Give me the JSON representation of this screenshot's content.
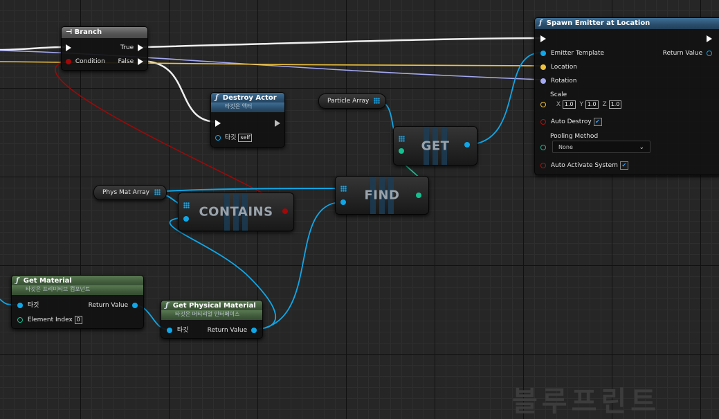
{
  "nodes": {
    "branch": {
      "title": "Branch",
      "true_label": "True",
      "false_label": "False",
      "condition_label": "Condition"
    },
    "destroy_actor": {
      "title": "Destroy Actor",
      "subtitle": "타깃은 액터",
      "target_label": "타깃",
      "target_value": "self"
    },
    "spawn_emitter": {
      "title": "Spawn Emitter at Location",
      "emitter_template_label": "Emitter Template",
      "return_value_label": "Return Value",
      "location_label": "Location",
      "rotation_label": "Rotation",
      "scale_label": "Scale",
      "scale_x_label": "X",
      "scale_x": "1.0",
      "scale_y_label": "Y",
      "scale_y": "1.0",
      "scale_z_label": "Z",
      "scale_z": "1.0",
      "auto_destroy_label": "Auto Destroy",
      "pooling_method_label": "Pooling Method",
      "pooling_method_value": "None",
      "auto_activate_label": "Auto Activate System"
    },
    "get_material": {
      "title": "Get Material",
      "subtitle": "타깃은 프리미티브 컴포넌트",
      "target_label": "타깃",
      "return_value_label": "Return Value",
      "element_index_label": "Element Index",
      "element_index_value": "0"
    },
    "get_physical_material": {
      "title": "Get Physical Material",
      "subtitle": "타깃은 머티리얼 인터페이스",
      "target_label": "타깃",
      "return_value_label": "Return Value"
    },
    "get": {
      "title": "GET"
    },
    "find": {
      "title": "FIND"
    },
    "contains": {
      "title": "CONTAINS"
    }
  },
  "variables": {
    "particle_array": "Particle Array",
    "phys_mat_array": "Phys Mat Array"
  },
  "icons": {
    "function": "ƒ",
    "branch": "branch-icon",
    "exec_pin": "exec-pin-icon",
    "array_pin": "array-grid-icon",
    "chevron": "chevron-down-icon"
  },
  "colors": {
    "exec_wire": "#ffffff",
    "object_wire": "#0fa7e8",
    "vector_wire": "#f0c23c",
    "rotator_wire": "#a5a9f0",
    "bool_wire": "#a30707",
    "int_wire": "#15c090",
    "function_header": "#2a4e6c",
    "pure_header": "#3f5a3a"
  },
  "watermark": "블루프린트"
}
